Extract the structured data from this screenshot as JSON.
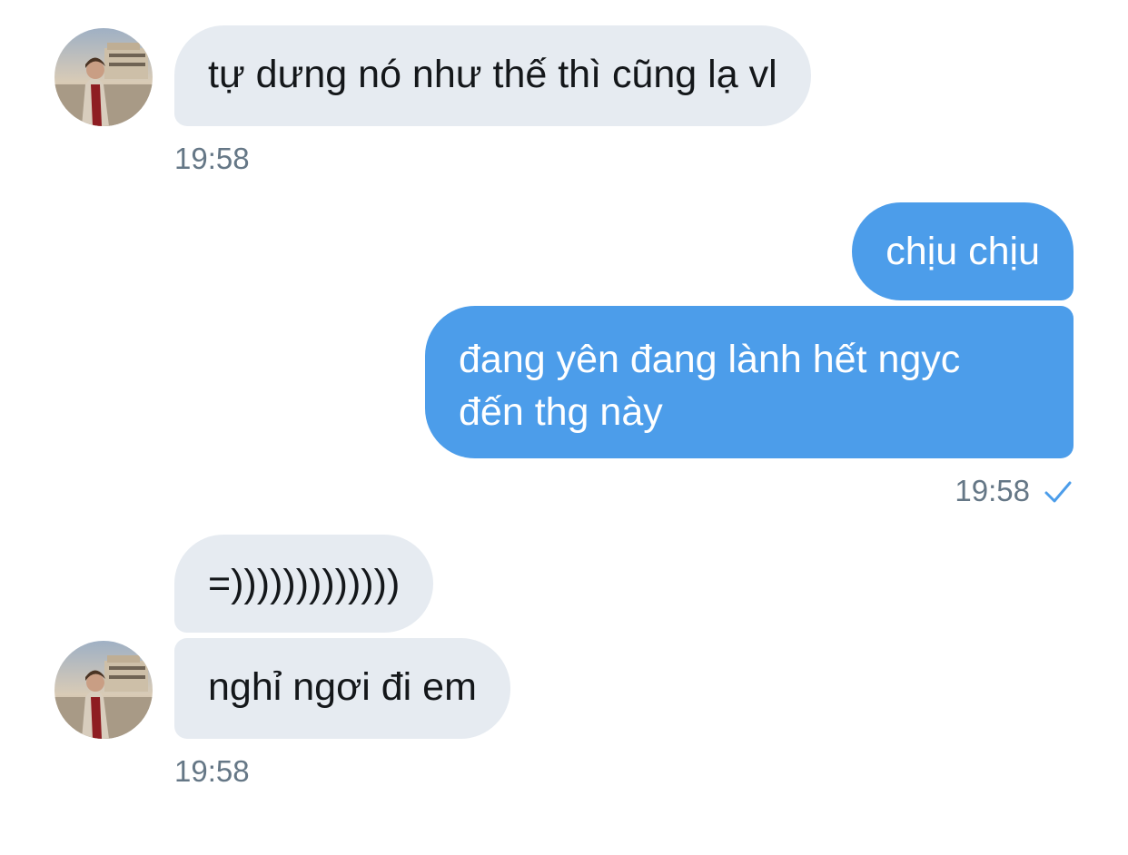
{
  "conversation": {
    "messages": [
      {
        "direction": "incoming",
        "text": "tự dưng nó như thế thì cũng lạ vl"
      },
      {
        "direction": "outgoing",
        "text": "chịu chịu"
      },
      {
        "direction": "outgoing",
        "text_line1": "đang yên đang lành hết ngyc",
        "text_line2": "đến thg này"
      },
      {
        "direction": "incoming",
        "text": "=)))))))))))))"
      },
      {
        "direction": "incoming",
        "text": "nghỉ ngơi đi em"
      }
    ],
    "timestamps": {
      "group1": "19:58",
      "group2": "19:58",
      "group3": "19:58"
    },
    "read_status": "sent-checkmark-icon"
  },
  "colors": {
    "incoming_bubble": "#e6ebf1",
    "outgoing_bubble": "#4c9dea",
    "timestamp": "#657786",
    "checkmark": "#4c9dea"
  }
}
